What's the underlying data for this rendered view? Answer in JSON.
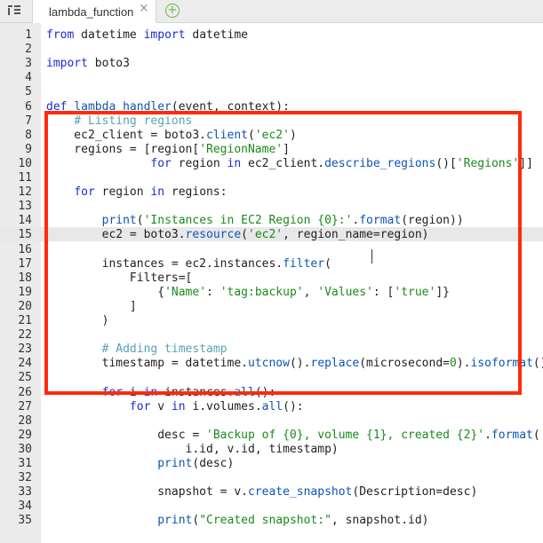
{
  "tab": {
    "label": "lambda_function",
    "close_glyph": "×",
    "new_tab_glyph": "+"
  },
  "icons": {
    "file_menu": "file-menu-icon",
    "close": "close-icon",
    "new_tab": "plus-circle-icon"
  },
  "colors": {
    "highlight_border": "#ff2a0a",
    "keyword": "#1a2bd6",
    "string": "#1a8a1a",
    "comment": "#5aa0b3",
    "function": "#0d55b8"
  },
  "editor": {
    "active_line": 15,
    "lines": [
      {
        "n": "1",
        "tokens": [
          {
            "t": "kw",
            "v": "from"
          },
          {
            "t": "",
            "v": " datetime "
          },
          {
            "t": "kw",
            "v": "import"
          },
          {
            "t": "",
            "v": " datetime"
          }
        ]
      },
      {
        "n": "2",
        "tokens": []
      },
      {
        "n": "3",
        "tokens": [
          {
            "t": "kw",
            "v": "import"
          },
          {
            "t": "",
            "v": " boto3"
          }
        ]
      },
      {
        "n": "4",
        "tokens": []
      },
      {
        "n": "5",
        "tokens": []
      },
      {
        "n": "6",
        "tokens": [
          {
            "t": "kw",
            "v": "def"
          },
          {
            "t": "",
            "v": " "
          },
          {
            "t": "fn",
            "v": "lambda_handler"
          },
          {
            "t": "",
            "v": "(event, context):"
          }
        ]
      },
      {
        "n": "7",
        "tokens": [
          {
            "t": "",
            "v": "    "
          },
          {
            "t": "cm",
            "v": "# Listing regions"
          }
        ]
      },
      {
        "n": "8",
        "tokens": [
          {
            "t": "",
            "v": "    ec2_client = boto3."
          },
          {
            "t": "fn",
            "v": "client"
          },
          {
            "t": "",
            "v": "("
          },
          {
            "t": "str",
            "v": "'ec2'"
          },
          {
            "t": "",
            "v": ")"
          }
        ]
      },
      {
        "n": "9",
        "tokens": [
          {
            "t": "",
            "v": "    regions = [region["
          },
          {
            "t": "str",
            "v": "'RegionName'"
          },
          {
            "t": "",
            "v": "]"
          }
        ]
      },
      {
        "n": "10",
        "tokens": [
          {
            "t": "",
            "v": "               "
          },
          {
            "t": "kw",
            "v": "for"
          },
          {
            "t": "",
            "v": " region "
          },
          {
            "t": "kw",
            "v": "in"
          },
          {
            "t": "",
            "v": " ec2_client."
          },
          {
            "t": "fn",
            "v": "describe_regions"
          },
          {
            "t": "",
            "v": "()["
          },
          {
            "t": "str",
            "v": "'Regions'"
          },
          {
            "t": "",
            "v": "]]"
          }
        ]
      },
      {
        "n": "11",
        "tokens": []
      },
      {
        "n": "12",
        "tokens": [
          {
            "t": "",
            "v": "    "
          },
          {
            "t": "kw",
            "v": "for"
          },
          {
            "t": "",
            "v": " region "
          },
          {
            "t": "kw",
            "v": "in"
          },
          {
            "t": "",
            "v": " regions:"
          }
        ]
      },
      {
        "n": "13",
        "tokens": []
      },
      {
        "n": "14",
        "tokens": [
          {
            "t": "",
            "v": "        "
          },
          {
            "t": "fn",
            "v": "print"
          },
          {
            "t": "",
            "v": "("
          },
          {
            "t": "str",
            "v": "'Instances in EC2 Region {0}:'"
          },
          {
            "t": "",
            "v": "."
          },
          {
            "t": "fn",
            "v": "format"
          },
          {
            "t": "",
            "v": "(region))"
          }
        ]
      },
      {
        "n": "15",
        "tokens": [
          {
            "t": "",
            "v": "        ec2 = boto3."
          },
          {
            "t": "fn",
            "v": "resource"
          },
          {
            "t": "",
            "v": "("
          },
          {
            "t": "str",
            "v": "'ec2'"
          },
          {
            "t": "",
            "v": ", region_name=region)"
          }
        ]
      },
      {
        "n": "16",
        "tokens": []
      },
      {
        "n": "17",
        "tokens": [
          {
            "t": "",
            "v": "        instances = ec2.instances."
          },
          {
            "t": "fn",
            "v": "filter"
          },
          {
            "t": "",
            "v": "("
          }
        ]
      },
      {
        "n": "18",
        "tokens": [
          {
            "t": "",
            "v": "            Filters=["
          }
        ]
      },
      {
        "n": "19",
        "tokens": [
          {
            "t": "",
            "v": "                {"
          },
          {
            "t": "str",
            "v": "'Name'"
          },
          {
            "t": "",
            "v": ": "
          },
          {
            "t": "str",
            "v": "'tag:backup'"
          },
          {
            "t": "",
            "v": ", "
          },
          {
            "t": "str",
            "v": "'Values'"
          },
          {
            "t": "",
            "v": ": ["
          },
          {
            "t": "str",
            "v": "'true'"
          },
          {
            "t": "",
            "v": "]}"
          }
        ]
      },
      {
        "n": "20",
        "tokens": [
          {
            "t": "",
            "v": "            ]"
          }
        ]
      },
      {
        "n": "21",
        "tokens": [
          {
            "t": "",
            "v": "        )"
          }
        ]
      },
      {
        "n": "22",
        "tokens": []
      },
      {
        "n": "23",
        "tokens": [
          {
            "t": "",
            "v": "        "
          },
          {
            "t": "cm",
            "v": "# Adding timestamp"
          }
        ]
      },
      {
        "n": "24",
        "tokens": [
          {
            "t": "",
            "v": "        timestamp = datetime."
          },
          {
            "t": "fn",
            "v": "utcnow"
          },
          {
            "t": "",
            "v": "()."
          },
          {
            "t": "fn",
            "v": "replace"
          },
          {
            "t": "",
            "v": "(microsecond="
          },
          {
            "t": "num",
            "v": "0"
          },
          {
            "t": "",
            "v": ")."
          },
          {
            "t": "fn",
            "v": "isoformat"
          },
          {
            "t": "",
            "v": "()"
          }
        ]
      },
      {
        "n": "25",
        "tokens": []
      },
      {
        "n": "26",
        "tokens": [
          {
            "t": "",
            "v": "        "
          },
          {
            "t": "kw",
            "v": "for"
          },
          {
            "t": "",
            "v": " i "
          },
          {
            "t": "kw",
            "v": "in"
          },
          {
            "t": "",
            "v": " instances."
          },
          {
            "t": "fn",
            "v": "all"
          },
          {
            "t": "",
            "v": "():"
          }
        ]
      },
      {
        "n": "27",
        "tokens": [
          {
            "t": "",
            "v": "            "
          },
          {
            "t": "kw",
            "v": "for"
          },
          {
            "t": "",
            "v": " v "
          },
          {
            "t": "kw",
            "v": "in"
          },
          {
            "t": "",
            "v": " i.volumes."
          },
          {
            "t": "fn",
            "v": "all"
          },
          {
            "t": "",
            "v": "():"
          }
        ]
      },
      {
        "n": "28",
        "tokens": []
      },
      {
        "n": "29",
        "tokens": [
          {
            "t": "",
            "v": "                desc = "
          },
          {
            "t": "str",
            "v": "'Backup of {0}, volume {1}, created {2}'"
          },
          {
            "t": "",
            "v": "."
          },
          {
            "t": "fn",
            "v": "format"
          },
          {
            "t": "",
            "v": "("
          }
        ]
      },
      {
        "n": "30",
        "tokens": [
          {
            "t": "",
            "v": "                    i.id, v.id, timestamp)"
          }
        ]
      },
      {
        "n": "31",
        "tokens": [
          {
            "t": "",
            "v": "                "
          },
          {
            "t": "fn",
            "v": "print"
          },
          {
            "t": "",
            "v": "(desc)"
          }
        ]
      },
      {
        "n": "32",
        "tokens": []
      },
      {
        "n": "33",
        "tokens": [
          {
            "t": "",
            "v": "                snapshot = v."
          },
          {
            "t": "fn",
            "v": "create_snapshot"
          },
          {
            "t": "",
            "v": "(Description=desc)"
          }
        ]
      },
      {
        "n": "34",
        "tokens": []
      },
      {
        "n": "35",
        "tokens": [
          {
            "t": "",
            "v": "                "
          },
          {
            "t": "fn",
            "v": "print"
          },
          {
            "t": "",
            "v": "("
          },
          {
            "t": "str",
            "v": "\"Created snapshot:\""
          },
          {
            "t": "",
            "v": ", snapshot.id)"
          }
        ]
      }
    ]
  }
}
